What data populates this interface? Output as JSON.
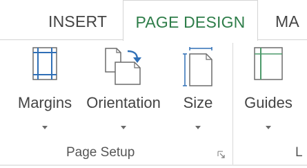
{
  "tabs": {
    "insert": "INSERT",
    "page_design": "PAGE DESIGN",
    "next_partial": "MA"
  },
  "ribbon": {
    "buttons": [
      {
        "label": "Margins",
        "icon": "margins-icon"
      },
      {
        "label": "Orientation",
        "icon": "orientation-icon"
      },
      {
        "label": "Size",
        "icon": "page-size-icon"
      },
      {
        "label": "Guides",
        "icon": "guides-icon"
      }
    ],
    "groups": {
      "page_setup": "Page Setup",
      "next_partial": "L"
    }
  },
  "colors": {
    "active_tab_text": "#2e7d49",
    "icon_blue": "#2f6fb6",
    "icon_green": "#4c9a6a",
    "text": "#444444",
    "border": "#d4d4d4"
  }
}
